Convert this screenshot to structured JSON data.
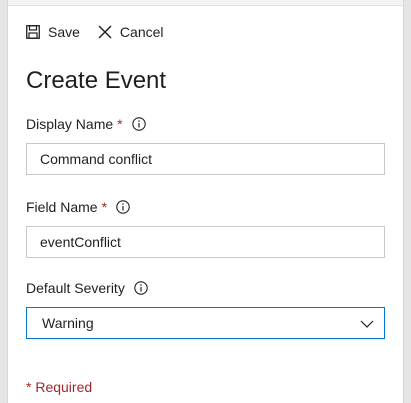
{
  "toolbar": {
    "save_label": "Save",
    "save_icon": "save-icon",
    "cancel_label": "Cancel",
    "cancel_icon": "close-icon"
  },
  "form": {
    "title": "Create Event",
    "required_marker": "*",
    "display_name": {
      "label": "Display Name",
      "value": "Command conflict"
    },
    "field_name": {
      "label": "Field Name",
      "value": "eventConflict"
    },
    "default_severity": {
      "label": "Default Severity",
      "value": "Warning"
    },
    "required_note": "* Required"
  },
  "colors": {
    "required": "#a4262c",
    "focus_border": "#0078d4",
    "input_border": "#c8c8c8"
  }
}
